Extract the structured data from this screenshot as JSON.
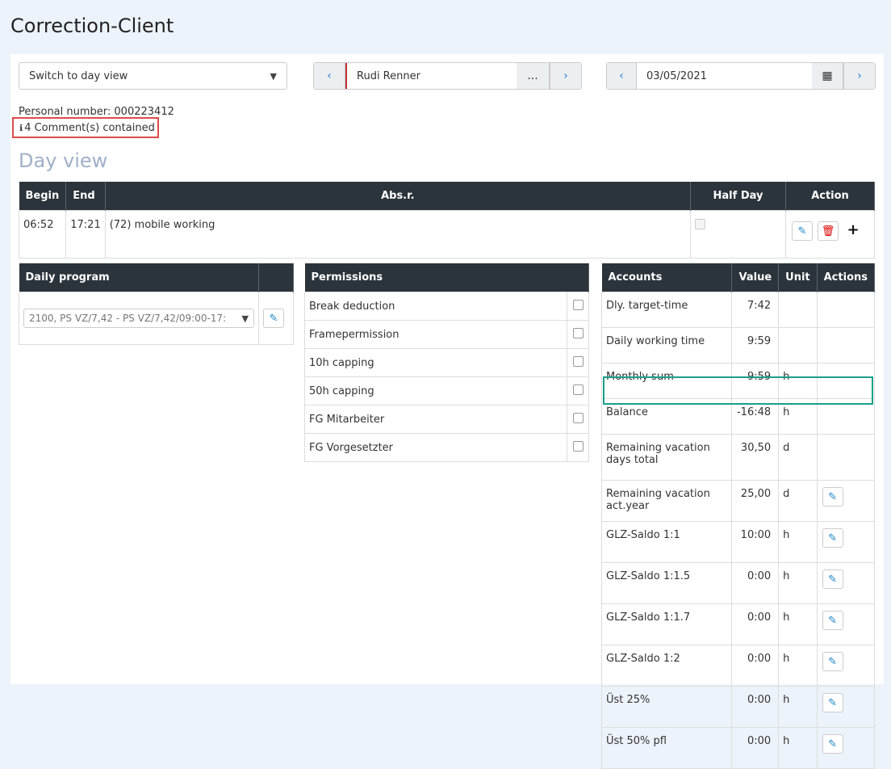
{
  "title": "Correction-Client",
  "view_select": "Switch to day view",
  "employee": {
    "name": "Rudi Renner",
    "more": "...",
    "prev": "‹",
    "next": "›"
  },
  "date": {
    "value": "03/05/2021",
    "prev": "‹",
    "next": "›"
  },
  "personal_number": "Personal number: 000223412",
  "comments": "4 Comment(s) contained",
  "section_title": "Day view",
  "dayview": {
    "headers": [
      "Begin",
      "End",
      "Abs.r.",
      "Half Day",
      "Action"
    ],
    "row": {
      "begin": "06:52",
      "end": "17:21",
      "absr": "(72) mobile working"
    }
  },
  "daily_program": {
    "header": "Daily program",
    "value": "2100, PS VZ/7,42 - PS VZ/7,42/09:00-17:"
  },
  "permissions": {
    "header": "Permissions",
    "items": [
      "Break deduction",
      "Framepermission",
      "10h capping",
      "50h capping",
      "FG Mitarbeiter",
      "FG Vorgesetzter"
    ]
  },
  "accounts": {
    "headers": [
      "Accounts",
      "Value",
      "Unit",
      "Actions"
    ],
    "rows": [
      {
        "name": "Dly. target-time",
        "value": "7:42",
        "unit": "",
        "edit": false
      },
      {
        "name": "Daily working time",
        "value": "9:59",
        "unit": "",
        "edit": false
      },
      {
        "name": "Monthly sum",
        "value": "9:59",
        "unit": "h",
        "edit": false
      },
      {
        "name": "Balance",
        "value": "-16:48",
        "unit": "h",
        "edit": false
      },
      {
        "name": "Remaining vacation days total",
        "value": "30,50",
        "unit": "d",
        "edit": false
      },
      {
        "name": "Remaining vacation act.year",
        "value": "25,00",
        "unit": "d",
        "edit": true
      },
      {
        "name": "GLZ-Saldo 1:1",
        "value": "10:00",
        "unit": "h",
        "edit": true
      },
      {
        "name": "GLZ-Saldo 1:1.5",
        "value": "0:00",
        "unit": "h",
        "edit": true
      },
      {
        "name": "GLZ-Saldo 1:1.7",
        "value": "0:00",
        "unit": "h",
        "edit": true
      },
      {
        "name": "GLZ-Saldo 1:2",
        "value": "0:00",
        "unit": "h",
        "edit": true
      },
      {
        "name": "Üst 25%",
        "value": "0:00",
        "unit": "h",
        "edit": true
      },
      {
        "name": "Üst 50% pfl",
        "value": "0:00",
        "unit": "h",
        "edit": true
      }
    ]
  },
  "colors": {
    "header_bg": "#2b333b",
    "comment_box": "#e04a4a",
    "balance_box": "#1aa088"
  }
}
